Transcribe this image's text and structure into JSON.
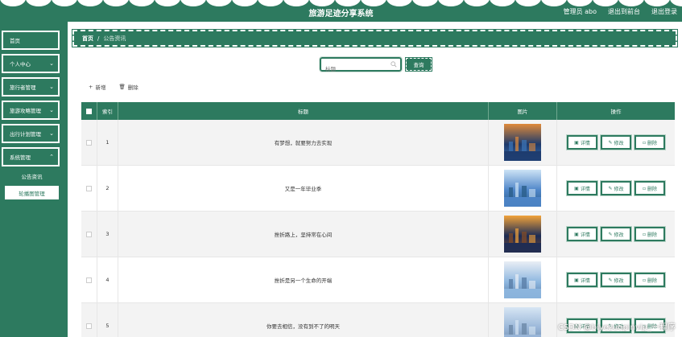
{
  "header": {
    "title": "旅游足迹分享系统",
    "role_user": "管理员 abo",
    "back_to_front": "退出到前台",
    "logout": "退出登录"
  },
  "sidebar": {
    "items": [
      {
        "label": "首页"
      },
      {
        "label": "个人中心"
      },
      {
        "label": "旅行者管理"
      },
      {
        "label": "旅游攻略管理"
      },
      {
        "label": "出行计划管理"
      },
      {
        "label": "系统管理"
      }
    ],
    "sub_items": [
      {
        "label": "公告资讯"
      },
      {
        "label": "轮播图管理"
      }
    ]
  },
  "breadcrumb": {
    "home": "首页",
    "sep": "/",
    "current": "公告资讯"
  },
  "search": {
    "placeholder": "标题",
    "button": "查询"
  },
  "toolbar": {
    "add": "新增",
    "delete": "删除"
  },
  "table": {
    "headers": {
      "index": "索引",
      "title": "标题",
      "image": "图片",
      "ops": "操作"
    },
    "rows": [
      {
        "index": "1",
        "title": "有梦想，就要努力去实现"
      },
      {
        "index": "2",
        "title": "又是一年毕业季"
      },
      {
        "index": "3",
        "title": "挫折路上，坚持常在心间"
      },
      {
        "index": "4",
        "title": "挫折是另一个生命的开端"
      },
      {
        "index": "5",
        "title": "你要去相信，没有到不了的明天"
      }
    ],
    "op_labels": {
      "detail": "详情",
      "edit": "修改",
      "delete": "删除"
    }
  },
  "watermark": "CSDN @biyezuopinvip_一程序",
  "colors": {
    "primary": "#2d7a5f",
    "white": "#ffffff"
  }
}
